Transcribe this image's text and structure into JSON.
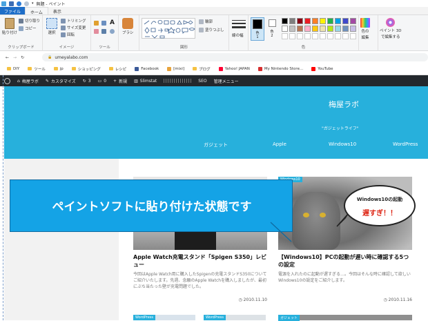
{
  "paint": {
    "title": "無題 - ペイント",
    "menu": {
      "file": "ファイル",
      "home": "ホーム",
      "view": "表示"
    },
    "ribbon": {
      "paste": "貼り付け",
      "cut": "切り取り",
      "copy": "コピー",
      "clipboard_group": "クリップボード",
      "select": "選択",
      "trim": "トリミング",
      "resize": "サイズ変更",
      "rotate": "回転",
      "image_group": "イメージ",
      "tools_group": "ツール",
      "brush": "ブラシ",
      "outline": "輪郭",
      "fill": "塗りつぶし",
      "shapes_group": "図形",
      "line_width": "線の幅",
      "color1": "色",
      "color1_num": "1",
      "color2": "色",
      "color2_num": "2",
      "colors_group": "色",
      "edit_colors_1": "色の",
      "edit_colors_2": "編集",
      "paint3d_1": "ペイント 3D",
      "paint3d_2": "で編集する"
    },
    "palette": [
      "#000000",
      "#7f7f7f",
      "#880015",
      "#ed1c24",
      "#ff7f27",
      "#fff200",
      "#22b14c",
      "#00a2e8",
      "#3f48cc",
      "#a349a4",
      "#ffffff",
      "#c3c3c3",
      "#b97a57",
      "#ffaec9",
      "#ffc90e",
      "#efe4b0",
      "#b5e61d",
      "#99d9ea",
      "#7092be",
      "#c8bfe7"
    ]
  },
  "browser": {
    "url": "umeyalabo.com",
    "bookmarks": [
      "DIY",
      "ツール",
      "jp",
      "ショッピング",
      "レシピ",
      "Facebook",
      "[mixi]",
      "ブログ",
      "Yahoo! JAPAN",
      "My Nintendo Store...",
      "YouTube"
    ]
  },
  "wp_admin": {
    "site_name": "梅屋ラボ",
    "customize": "カスタマイズ",
    "updates": "3",
    "comments": "0",
    "new": "新規",
    "slimstat": "Slimstat",
    "seo": "SEO",
    "admin_menu": "管理メニュー"
  },
  "site": {
    "title": "梅屋ラボ",
    "tagline": "\"ガジェットライフ\"",
    "nav": [
      "ガジェット",
      "Apple",
      "Windows10",
      "WordPress"
    ]
  },
  "cards": [
    {
      "category": "",
      "title": "Apple Watch充電スタンド「Spigen S350」レビュー",
      "excerpt": "今回はApple Watch用に購入したSpigenの充電スタンドS350についてご紹介いたします。先週、念願のApple Watchを購入しましたが、最初にぶち当たった壁が充電問題でした。",
      "date": "2010.11.10"
    },
    {
      "category": "Windows10",
      "title": "【Windows10】PCの起動が遅い時に確認する5つの設定",
      "excerpt": "電源を入れたのに起動が遅すぎる…。今回はそんな時に確認して欲しいWindows10の設定をご紹介します。",
      "date": "2010.11.16"
    }
  ],
  "bubble": {
    "line1": "Windows10の起動",
    "line2": "遅すぎ！！"
  },
  "callout": "ペイントソフトに貼り付けた状態です",
  "bottom_tags": [
    "WordPress",
    "WordPress",
    "ガジェット"
  ]
}
